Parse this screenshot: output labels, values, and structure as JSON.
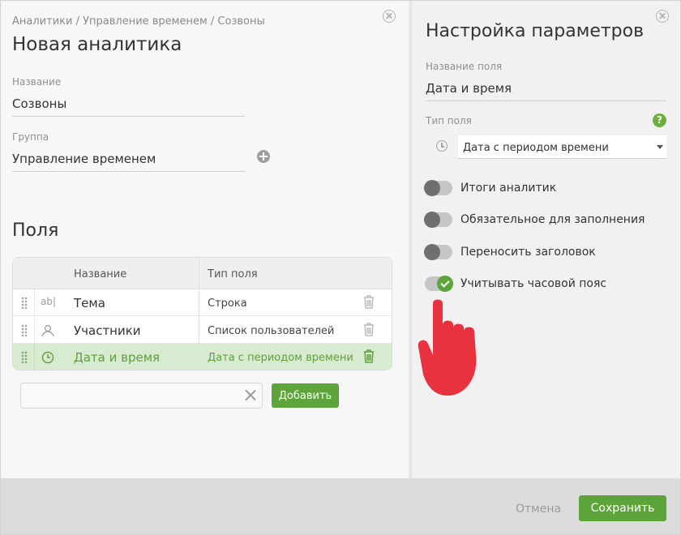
{
  "left": {
    "breadcrumb": "Аналитики / Управление временем / Созвоны",
    "title": "Новая аналитика",
    "name_label": "Название",
    "name_value": "Созвоны",
    "group_label": "Группа",
    "group_value": "Управление временем",
    "fields_title": "Поля",
    "table": {
      "headers": [
        "Название",
        "Тип поля"
      ],
      "rows": [
        {
          "icon": "text-ab-icon",
          "icon_text": "ab|",
          "name": "Тема",
          "type": "Строка",
          "selected": false
        },
        {
          "icon": "user-icon",
          "name": "Участники",
          "type": "Список пользователей",
          "selected": false
        },
        {
          "icon": "clock-icon",
          "name": "Дата и время",
          "type": "Дата с периодом времени",
          "selected": true
        }
      ]
    },
    "add_input_value": "",
    "add_button": "Добавить"
  },
  "right": {
    "title": "Настройка параметров",
    "field_name_label": "Название поля",
    "field_name_value": "Дата и время",
    "field_type_label": "Тип поля",
    "help_glyph": "?",
    "field_type_value": "Дата с периодом времени",
    "toggles": [
      {
        "label": "Итоги аналитик",
        "on": false
      },
      {
        "label": "Обязательное для заполнения",
        "on": false
      },
      {
        "label": "Переносить заголовок",
        "on": false
      },
      {
        "label": "Учитывать часовой пояс",
        "on": true
      }
    ]
  },
  "footer": {
    "cancel": "Отмена",
    "save": "Сохранить"
  },
  "colors": {
    "accent": "#5da43b",
    "selected_row": "#d8ead0",
    "hand": "#e8323f"
  }
}
